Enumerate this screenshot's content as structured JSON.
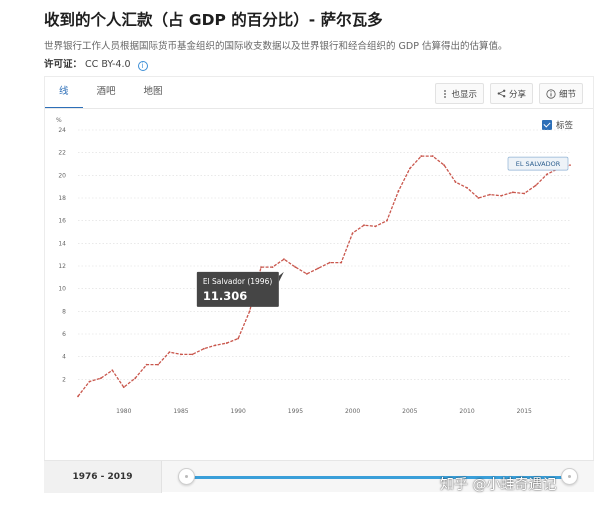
{
  "header": {
    "title": "收到的个人汇款（占 GDP 的百分比）- 萨尔瓦多",
    "subtitle": "世界银行工作人员根据国际货币基金组织的国际收支数据以及世界银行和经合组织的 GDP 估算得出的估算值。",
    "license_label": "许可证：",
    "license_value": "CC BY-4.0"
  },
  "tabs": [
    {
      "label": "线",
      "active": true
    },
    {
      "label": "酒吧",
      "active": false
    },
    {
      "label": "地图",
      "active": false
    }
  ],
  "toolbar": {
    "also_show": "也显示",
    "share": "分享",
    "details": "细节"
  },
  "label_toggle": {
    "label": "标签",
    "checked": true
  },
  "chart_data": {
    "type": "line",
    "ylabel": "%",
    "xlim": [
      1976,
      2019
    ],
    "ylim": [
      0,
      24
    ],
    "y_ticks": [
      2,
      4,
      6,
      8,
      10,
      12,
      14,
      16,
      18,
      20,
      22,
      24
    ],
    "x_tick_labels": [
      "1980",
      "1985",
      "1990",
      "1995",
      "2000",
      "2005",
      "2010",
      "2015"
    ],
    "series": [
      {
        "name": "EL SALVADOR",
        "color": "#c9574d",
        "x": [
          1976,
          1977,
          1978,
          1979,
          1980,
          1981,
          1982,
          1983,
          1984,
          1985,
          1986,
          1987,
          1988,
          1989,
          1990,
          1991,
          1992,
          1993,
          1994,
          1995,
          1996,
          1997,
          1998,
          1999,
          2000,
          2001,
          2002,
          2003,
          2004,
          2005,
          2006,
          2007,
          2008,
          2009,
          2010,
          2011,
          2012,
          2013,
          2014,
          2015,
          2016,
          2017,
          2018,
          2019
        ],
        "y": [
          0.5,
          1.8,
          2.1,
          2.8,
          1.3,
          2.1,
          3.3,
          3.3,
          4.4,
          4.2,
          4.2,
          4.7,
          5.0,
          5.2,
          5.6,
          8.0,
          11.9,
          11.9,
          12.6,
          11.9,
          11.306,
          11.8,
          12.3,
          12.3,
          14.9,
          15.6,
          15.5,
          16.0,
          18.6,
          20.6,
          21.7,
          21.7,
          20.9,
          19.4,
          18.9,
          18.0,
          18.3,
          18.2,
          18.5,
          18.4,
          19.1,
          20.1,
          20.6,
          20.9
        ]
      }
    ],
    "tooltip": {
      "label": "El Salvador (1996)",
      "value": "11.306",
      "x": 1996
    },
    "grid": true,
    "legend_position": "right"
  },
  "range": {
    "label": "1976 - 2019",
    "start_fraction": 0,
    "end_fraction": 1
  },
  "watermark": "知乎 @小蛙奇遇记"
}
